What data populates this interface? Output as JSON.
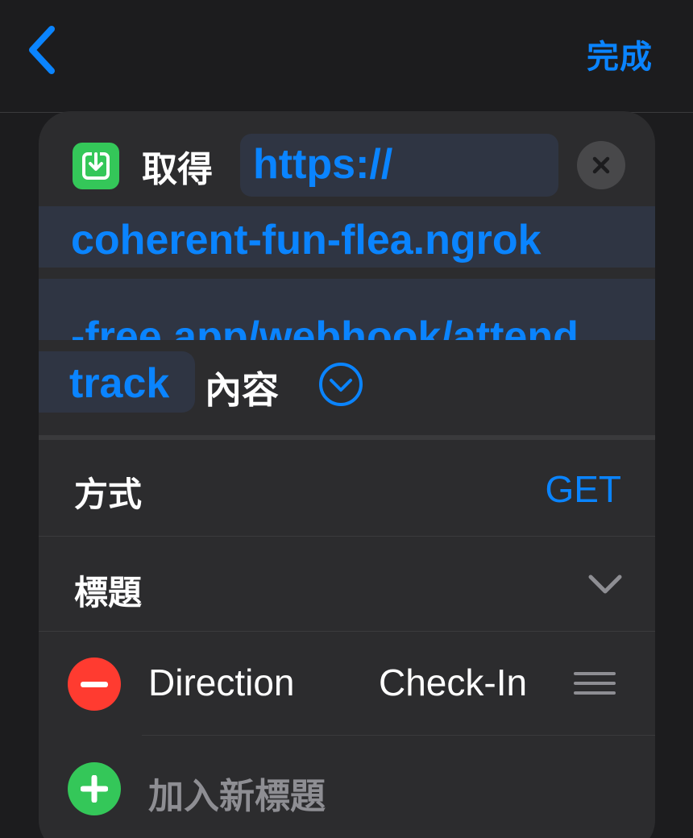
{
  "nav": {
    "back_icon": "chevron-left-icon",
    "done_label": "完成"
  },
  "action": {
    "icon": "download-icon",
    "verb": "取得",
    "url_line1": "https://",
    "url_line2": "coherent-fun-flea.ngrok",
    "url_line3": "-free.app/webhook/attend",
    "url_line4": "track",
    "content_label": "內容",
    "expand_icon": "chevron-down-circle-icon",
    "clear_icon": "close-icon"
  },
  "method": {
    "label": "方式",
    "value": "GET"
  },
  "headers": {
    "label": "標題",
    "items": [
      {
        "key": "Direction",
        "value": "Check-In"
      }
    ],
    "add_label": "加入新標題"
  },
  "colors": {
    "accent": "#0a84ff",
    "background": "#1c1c1e",
    "card": "#2c2c2e",
    "token_bg": "#2f3543",
    "delete": "#ff3b30",
    "add": "#34c759"
  }
}
